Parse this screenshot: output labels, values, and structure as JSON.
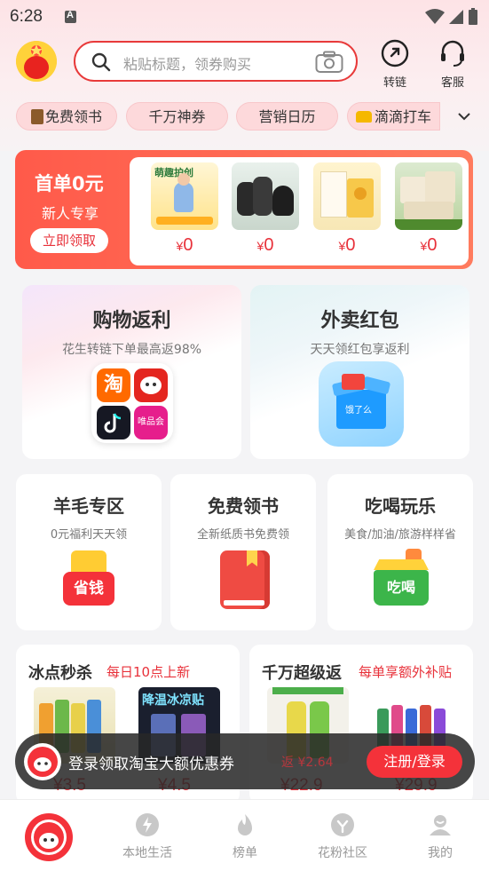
{
  "status_bar": {
    "time": "6:28"
  },
  "header": {
    "search_placeholder": "粘贴标题，领券购买",
    "convert_label": "转链",
    "service_label": "客服"
  },
  "chips": [
    {
      "label": "免费领书",
      "icon": "book-icon"
    },
    {
      "label": "千万神券",
      "icon": ""
    },
    {
      "label": "营销日历",
      "icon": ""
    },
    {
      "label": "滴滴打车",
      "icon": "taxi-icon"
    }
  ],
  "banner": {
    "title": "首单0元",
    "subtitle": "新人专享",
    "button": "立即领取",
    "products": [
      {
        "price_symbol": "¥",
        "price": "0",
        "caption": "萌趣护创"
      },
      {
        "price_symbol": "¥",
        "price": "0",
        "caption": ""
      },
      {
        "price_symbol": "¥",
        "price": "0",
        "caption": ""
      },
      {
        "price_symbol": "¥",
        "price": "0",
        "caption": ""
      }
    ]
  },
  "big_cards": [
    {
      "title": "购物返利",
      "subtitle": "花生转链下单最高返98%",
      "apps": [
        "淘",
        "京东",
        "抖音",
        "唯品会"
      ]
    },
    {
      "title": "外卖红包",
      "subtitle": "天天领红包享返利",
      "icon_text": "饿了么"
    }
  ],
  "mid_cards": [
    {
      "title": "羊毛专区",
      "subtitle": "0元福利天天领",
      "icon_text": "省钱"
    },
    {
      "title": "免费领书",
      "subtitle": "全新纸质书免费领",
      "icon_text": ""
    },
    {
      "title": "吃喝玩乐",
      "subtitle": "美食/加油/旅游样样省",
      "icon_text": "吃喝"
    }
  ],
  "deals": [
    {
      "title": "冰点秒杀",
      "tag": "每日10点上新",
      "prices": [
        "¥3.5",
        "¥4.5"
      ],
      "product_label": "降温冰凉贴"
    },
    {
      "title": "千万超级返",
      "tag": "每单享额外补贴",
      "prices": [
        "¥22.9",
        "¥29.9"
      ],
      "rebate": "返 ¥2.64"
    }
  ],
  "toast": {
    "message": "登录领取淘宝大额优惠券",
    "button": "注册/登录"
  },
  "tabbar": [
    {
      "label": "",
      "icon": "home-logo-icon"
    },
    {
      "label": "本地生活",
      "icon": "lightning-icon"
    },
    {
      "label": "榜单",
      "icon": "flame-icon"
    },
    {
      "label": "花粉社区",
      "icon": "community-icon"
    },
    {
      "label": "我的",
      "icon": "user-icon"
    }
  ],
  "colors": {
    "accent": "#f4323a",
    "chip_bg": "#fdd9db",
    "banner": "#ff5a4a"
  }
}
